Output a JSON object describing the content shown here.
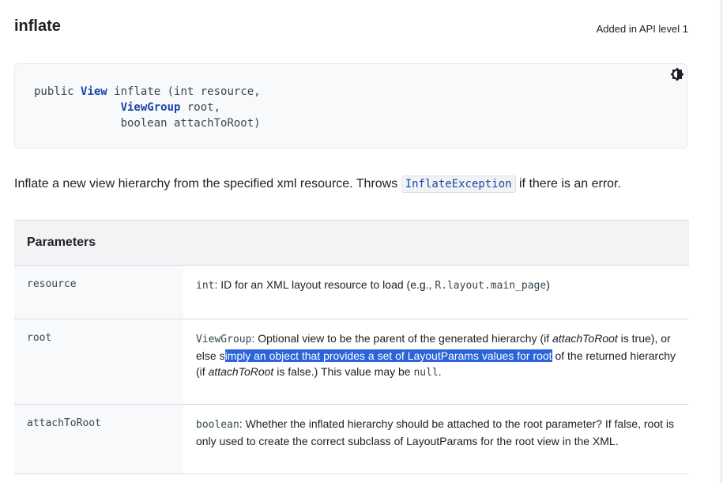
{
  "method": {
    "title": "inflate",
    "api_level": "Added in API level 1",
    "signature": {
      "line1_modifier": "public",
      "line1_type": "View",
      "line1_rest": "inflate (int resource,",
      "line2_type": "ViewGroup",
      "line2_rest": "root,",
      "line3": "boolean attachToRoot)"
    },
    "theme_icon": "theme-toggle-icon"
  },
  "description": {
    "before": "Inflate a new view hierarchy from the specified xml resource. Throws",
    "code": "InflateException",
    "after": "if there is an error."
  },
  "parameters": {
    "header": "Parameters",
    "rows": [
      {
        "name": "resource",
        "type": "int",
        "t1": ": ID for an XML layout resource to load (e.g., ",
        "c1": "R.layout.main_page",
        "t2": ")"
      },
      {
        "name": "root",
        "type": "ViewGroup",
        "t1": ": Optional view to be the parent of the generated hierarchy (if ",
        "i1": "attachToRoot",
        "t2": " is true), or else s",
        "highlight": "imply an object that provides a set of LayoutParams values for root",
        "t3": " of the returned hierarchy (if ",
        "i2": "attachToRoot",
        "t4": " is false.) This value may be ",
        "c1": "null",
        "t5": "."
      },
      {
        "name": "attachToRoot",
        "type": "boolean",
        "t1": ": Whether the inflated hierarchy should be attached to the root parameter? If false, root is only used to create the correct subclass of LayoutParams for the root view in the XML."
      }
    ]
  },
  "colors": {
    "keyword": "#1a47a8",
    "highlight": "#2b64d8"
  }
}
